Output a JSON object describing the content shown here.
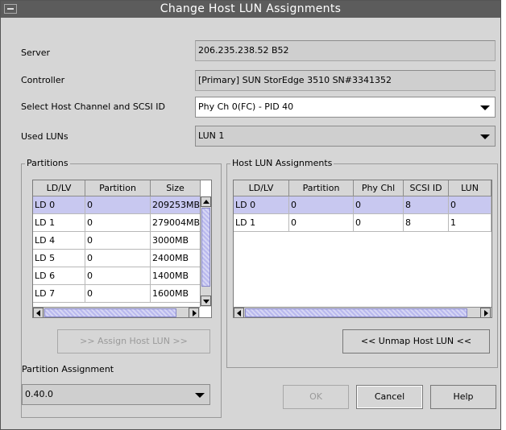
{
  "window": {
    "title": "Change Host LUN Assignments"
  },
  "form": {
    "server_label": "Server",
    "server_value": "206.235.238.52 B52",
    "controller_label": "Controller",
    "controller_value": "[Primary] SUN StorEdge 3510 SN#3341352",
    "channel_label": "Select Host Channel and SCSI ID",
    "channel_value": "Phy Ch 0(FC) - PID 40",
    "used_luns_label": "Used LUNs",
    "used_luns_value": "LUN 1"
  },
  "partitions": {
    "title": "Partitions",
    "columns": [
      "LD/LV",
      "Partition",
      "Size"
    ],
    "rows": [
      [
        "LD 0",
        "0",
        "209253MB"
      ],
      [
        "LD 1",
        "0",
        "279004MB"
      ],
      [
        "LD 4",
        "0",
        "3000MB"
      ],
      [
        "LD 5",
        "0",
        "2400MB"
      ],
      [
        "LD 6",
        "0",
        "1400MB"
      ],
      [
        "LD 7",
        "0",
        "1600MB"
      ]
    ],
    "selected_row": 0,
    "assign_button": ">> Assign Host LUN >>",
    "assignment_label": "Partition Assignment",
    "assignment_value": "0.40.0"
  },
  "host_luns": {
    "title": "Host LUN Assignments",
    "columns": [
      "LD/LV",
      "Partition",
      "Phy Chl",
      "SCSI ID",
      "LUN"
    ],
    "rows": [
      [
        "LD 0",
        "0",
        "0",
        "8",
        "0"
      ],
      [
        "LD 1",
        "0",
        "0",
        "8",
        "1"
      ]
    ],
    "selected_row": 0,
    "unmap_button": "<< Unmap Host LUN <<"
  },
  "buttons": {
    "ok": "OK",
    "cancel": "Cancel",
    "help": "Help"
  },
  "colors": {
    "titlebar": "#5c5c5c",
    "selection": "#c8c8f0",
    "window": "#d6d6d6"
  }
}
